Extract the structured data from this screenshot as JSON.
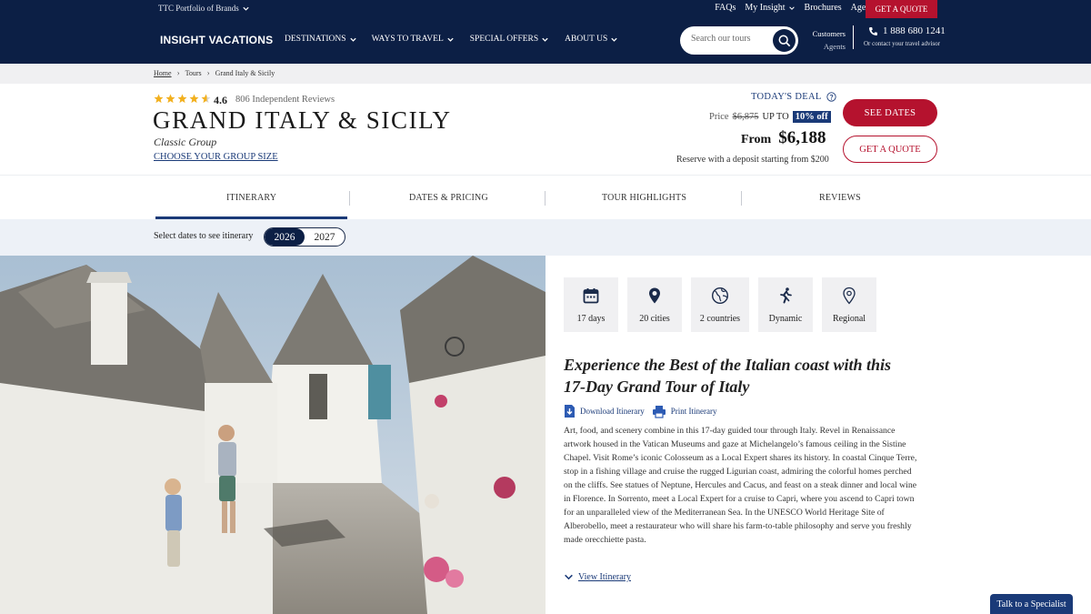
{
  "header": {
    "portfolio_label": "TTC Portfolio of Brands",
    "top_links": [
      "FAQs",
      "My Insight",
      "Brochures",
      "Agents"
    ],
    "quote_button": "GET A QUOTE",
    "logo": "INSIGHT VACATIONS",
    "nav": [
      "DESTINATIONS",
      "WAYS TO TRAVEL",
      "SPECIAL OFFERS",
      "ABOUT US"
    ],
    "search_placeholder": "Search our tours",
    "customers_label": "Customers",
    "agents_label": "Agents",
    "phone": "1 888 680 1241",
    "phone_sub": "Or contact your travel advisor",
    "colors": {
      "navy": "#0c1f45",
      "red": "#b5122e",
      "link": "#1a3a78"
    }
  },
  "breadcrumb": [
    "Home",
    "Tours",
    "Grand Italy & Sicily"
  ],
  "tour": {
    "rating": "4.6",
    "rating_value": 4.6,
    "reviews": "806 Independent Reviews",
    "title": "GRAND ITALY & SICILY",
    "subtitle": "Classic Group",
    "group_size_link": "CHOOSE YOUR GROUP SIZE"
  },
  "pricing": {
    "deal_label": "TODAY'S DEAL",
    "price_label": "Price",
    "old_price": "$6,875",
    "up_to": "UP TO",
    "discount": "10% off",
    "from_label": "From",
    "price": "$6,188",
    "deposit": "Reserve with a deposit starting from $200",
    "see_dates": "SEE DATES",
    "get_quote": "GET A QUOTE"
  },
  "tabs": [
    "ITINERARY",
    "DATES & PRICING",
    "TOUR HIGHLIGHTS",
    "REVIEWS"
  ],
  "dates": {
    "label": "Select dates to see itinerary",
    "years": [
      "2026",
      "2027"
    ],
    "active_year": "2026"
  },
  "features": [
    {
      "icon": "calendar-icon",
      "label": "17 days"
    },
    {
      "icon": "map-pin-icon",
      "label": "20 cities"
    },
    {
      "icon": "globe-icon",
      "label": "2 countries"
    },
    {
      "icon": "running-icon",
      "label": "Dynamic"
    },
    {
      "icon": "location-icon",
      "label": "Regional"
    }
  ],
  "overview": {
    "heading": "Experience the Best of the Italian coast with this 17-Day Grand Tour of Italy",
    "download": "Download Itinerary",
    "print": "Print Itinerary",
    "description": "Art, food, and scenery combine in this 17-day guided tour through Italy. Revel in Renaissance artwork housed in the Vatican Museums and gaze at Michelangelo’s famous ceiling in the Sistine Chapel. Visit Rome’s iconic Colosseum as a Local Expert shares its history. In coastal Cinque Terre, stop in a fishing village and cruise the rugged Ligurian coast, admiring the colorful homes perched on the cliffs. See statues of Neptune, Hercules and Cacus, and feast on a steak dinner and local wine in Florence. In Sorrento, meet a Local Expert for a cruise to Capri, where you ascend to Capri town for an unparalleled view of the Mediterranean Sea. In the UNESCO World Heritage Site of Alberobello, meet a restaurateur who will share his farm-to-table philosophy and serve you freshly made orecchiette pasta.",
    "view_itinerary": "View Itinerary"
  },
  "chat": {
    "label": "Talk to a Specialist"
  }
}
